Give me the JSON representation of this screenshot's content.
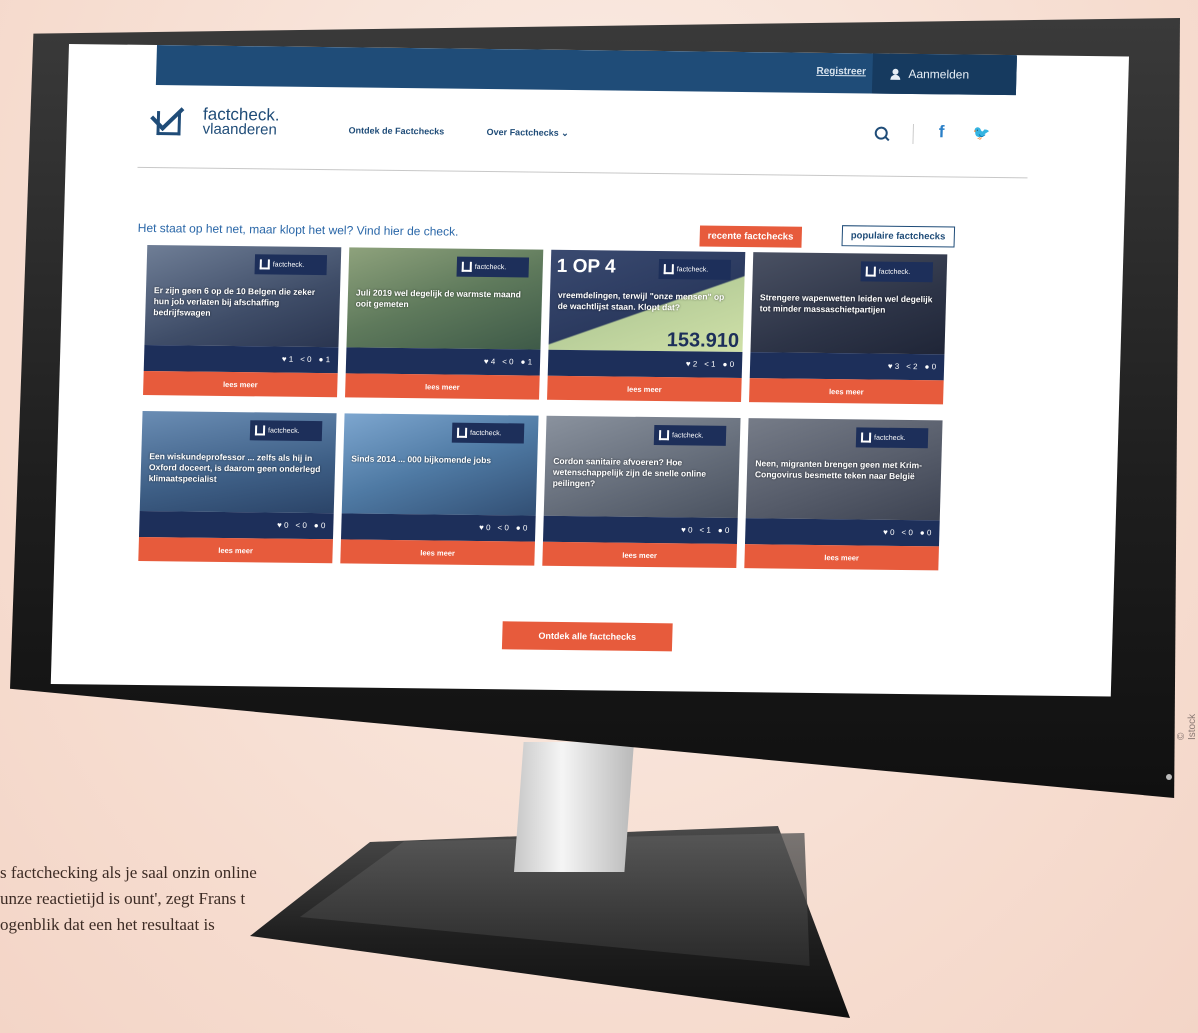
{
  "topbar": {
    "register": "Registreer",
    "login": "Aanmelden"
  },
  "logo": {
    "line1": "factcheck.",
    "line2": "vlaanderen",
    "mini": "factcheck."
  },
  "nav": {
    "discover": "Ontdek de Factchecks",
    "about": "Over Factchecks",
    "about_chevron": "⌄"
  },
  "social": {
    "facebook": "f",
    "twitter": "🐦"
  },
  "intro": "Het staat op het net, maar klopt het wel? Vind hier de check.",
  "tabs": {
    "recent": "recente factchecks",
    "popular": "populaire factchecks"
  },
  "cards": [
    {
      "title": "Er zijn geen 6 op de 10 Belgen die zeker hun job verlaten bij afschaffing bedrijfswagen",
      "likes": "1",
      "shares": "0",
      "comments": "1",
      "button": "lees meer"
    },
    {
      "title": "Juli 2019 wel degelijk de warmste maand ooit gemeten",
      "likes": "4",
      "shares": "0",
      "comments": "1",
      "button": "lees meer"
    },
    {
      "title": "vreemdelingen, terwijl \"onze mensen\" op de wachtlijst staan. Klopt dat?",
      "likes": "2",
      "shares": "1",
      "comments": "0",
      "button": "lees meer",
      "overlay": "1 OP 4",
      "overlay2": "153.910"
    },
    {
      "title": "Strengere wapenwetten leiden wel degelijk tot minder massaschietpartijen",
      "likes": "3",
      "shares": "2",
      "comments": "0",
      "button": "lees meer"
    },
    {
      "title": "Een wiskundeprofessor ... zelfs als hij in Oxford doceert, is daarom geen onderlegd klimaatspecialist",
      "likes": "0",
      "shares": "0",
      "comments": "0",
      "button": "lees meer"
    },
    {
      "title": "Sinds 2014 ... 000 bijkomende jobs",
      "likes": "0",
      "shares": "0",
      "comments": "0",
      "button": "lees meer"
    },
    {
      "title": "Cordon sanitaire afvoeren? Hoe wetenschappelijk zijn de snelle online peilingen?",
      "likes": "0",
      "shares": "1",
      "comments": "0",
      "button": "lees meer"
    },
    {
      "title": "Neen, migranten brengen geen met Krim-Congovirus besmette teken naar België",
      "likes": "0",
      "shares": "0",
      "comments": "0",
      "button": "lees meer"
    }
  ],
  "discover_all": "Ontdek alle factchecks",
  "caption": "s factchecking als je saal onzin online unze reactietijd is ount', zegt Frans t ogenblik dat een het resultaat is",
  "credit": "© Istock",
  "colors": {
    "navy": "#1d2f5a",
    "blue": "#1f4c78",
    "orange": "#e75b3c"
  }
}
